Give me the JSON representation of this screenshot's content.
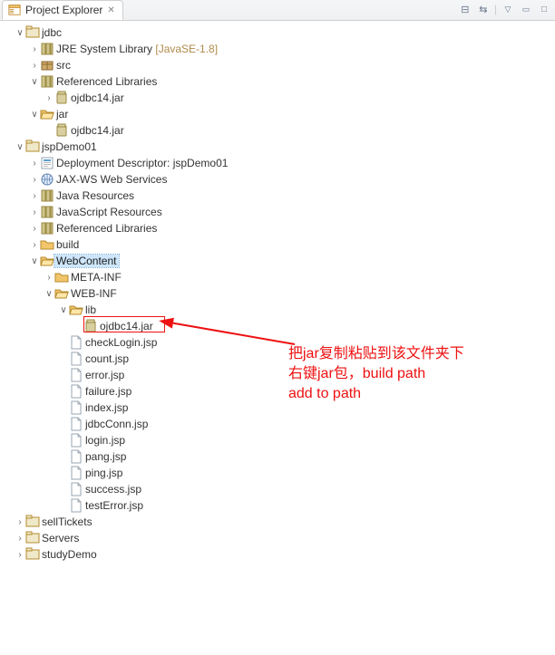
{
  "view": {
    "title": "Project Explorer",
    "toolbar": {
      "collapse_all": "⊟",
      "link": "⇵",
      "menu": "▿",
      "min": "▭",
      "max": "▢"
    }
  },
  "tree": {
    "jdbc": {
      "label": "jdbc",
      "jre": {
        "label": "JRE System Library",
        "deco": " [JavaSE-1.8]"
      },
      "src": "src",
      "reflib": "Referenced Libraries",
      "reflib_items": {
        "ojdbc": "ojdbc14.jar"
      },
      "jar_folder": "jar",
      "jar_items": {
        "ojdbc": "ojdbc14.jar"
      }
    },
    "jspDemo01": {
      "label": "jspDemo01",
      "depdesc": "Deployment Descriptor: jspDemo01",
      "jaxws": "JAX-WS Web Services",
      "javares": "Java Resources",
      "jsres": "JavaScript Resources",
      "reflib": "Referenced Libraries",
      "build": "build",
      "webcontent": {
        "label": "WebContent",
        "metainf": "META-INF",
        "webinf": {
          "label": "WEB-INF",
          "lib": {
            "label": "lib",
            "ojdbc": "ojdbc14.jar"
          },
          "files": {
            "checkLogin": "checkLogin.jsp",
            "count": "count.jsp",
            "error": "error.jsp",
            "failure": "failure.jsp",
            "index": "index.jsp",
            "jdbcConn": "jdbcConn.jsp",
            "login": "login.jsp",
            "pang": "pang.jsp",
            "ping": "ping.jsp",
            "success": "success.jsp",
            "testError": "testError.jsp"
          }
        }
      }
    },
    "sellTickets": "sellTickets",
    "Servers": "Servers",
    "studyDemo": "studyDemo"
  },
  "annotation": {
    "line1": "把jar复制粘贴到该文件夹下",
    "line2": "右键jar包，build path",
    "line3": "add to path"
  }
}
